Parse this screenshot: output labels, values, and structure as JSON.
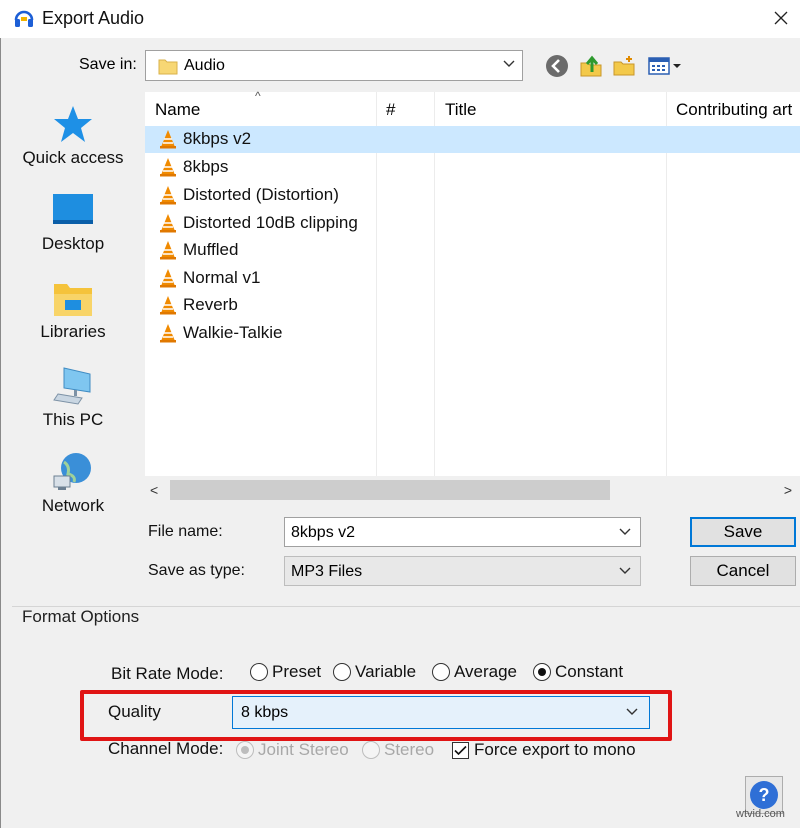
{
  "window": {
    "title": "Export Audio",
    "close_label": "✕"
  },
  "save_in": {
    "label": "Save in:",
    "value": "Audio"
  },
  "toolbar": {
    "icons": [
      "back-icon",
      "up-folder-icon",
      "new-folder-icon",
      "view-menu-icon"
    ]
  },
  "places": [
    {
      "label": "Quick access",
      "icon": "quick-access-icon"
    },
    {
      "label": "Desktop",
      "icon": "desktop-icon"
    },
    {
      "label": "Libraries",
      "icon": "libraries-icon"
    },
    {
      "label": "This PC",
      "icon": "this-pc-icon"
    },
    {
      "label": "Network",
      "icon": "network-icon"
    }
  ],
  "file_list": {
    "columns": [
      "Name",
      "#",
      "Title",
      "Contributing art"
    ],
    "sort_indicator": "^",
    "files": [
      {
        "name": "8kbps v2",
        "selected": true
      },
      {
        "name": "8kbps",
        "selected": false
      },
      {
        "name": "Distorted (Distortion)",
        "selected": false
      },
      {
        "name": "Distorted 10dB clipping",
        "selected": false
      },
      {
        "name": "Muffled",
        "selected": false
      },
      {
        "name": "Normal v1",
        "selected": false
      },
      {
        "name": "Reverb",
        "selected": false
      },
      {
        "name": "Walkie-Talkie",
        "selected": false
      }
    ]
  },
  "file_name": {
    "label": "File name:",
    "value": "8kbps v2"
  },
  "save_as_type": {
    "label": "Save as type:",
    "value": "MP3 Files"
  },
  "buttons": {
    "save": "Save",
    "cancel": "Cancel",
    "help": "?"
  },
  "format_options": {
    "title": "Format Options",
    "bit_rate_mode": {
      "label": "Bit Rate Mode:",
      "options": [
        {
          "label": "Preset",
          "checked": false
        },
        {
          "label": "Variable",
          "checked": false
        },
        {
          "label": "Average",
          "checked": false
        },
        {
          "label": "Constant",
          "checked": true
        }
      ]
    },
    "quality": {
      "label": "Quality",
      "value": "8 kbps"
    },
    "channel_mode": {
      "label": "Channel Mode:",
      "options": [
        {
          "label": "Joint Stereo",
          "checked": true,
          "disabled": true
        },
        {
          "label": "Stereo",
          "checked": false,
          "disabled": true
        }
      ],
      "force_mono_label": "Force export to mono",
      "force_mono_checked": true
    }
  },
  "highlight_color": "#e01414",
  "accent_color": "#0078d7",
  "watermark": "wtvid.com"
}
